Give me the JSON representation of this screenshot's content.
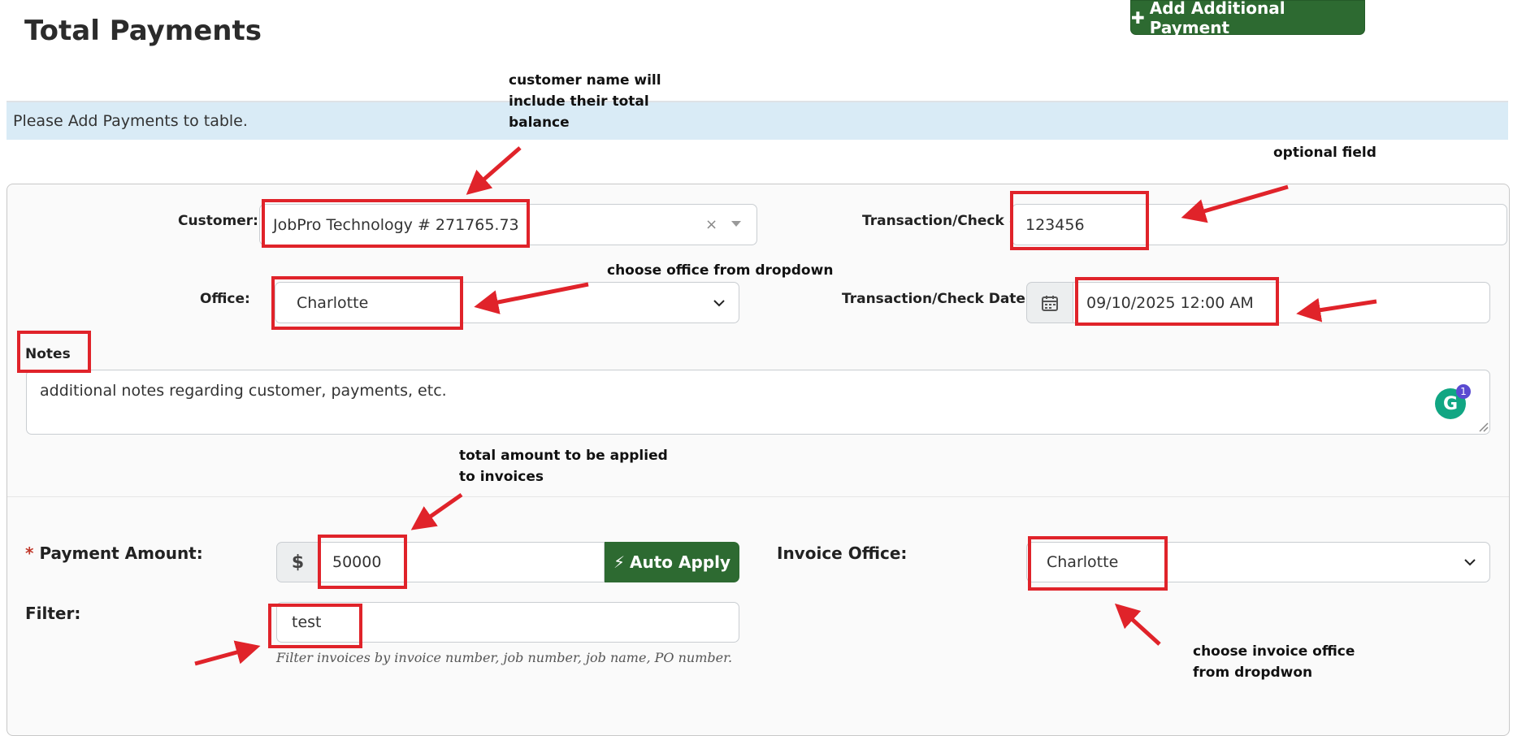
{
  "header": {
    "title": "Total Payments",
    "add_button_label": "Add Additional Payment",
    "add_button_icon": "plus-icon"
  },
  "info_bar": {
    "text": "Please Add Payments to table."
  },
  "form": {
    "customer": {
      "label": "Customer:",
      "value": "JobPro Technology # 271765.73",
      "clear_glyph": "×"
    },
    "transaction_number": {
      "label": "Transaction/Check #:",
      "value": "123456"
    },
    "office": {
      "label": "Office:",
      "value": "Charlotte"
    },
    "transaction_date": {
      "label": "Transaction/Check Date:",
      "value": "09/10/2025 12:00 AM"
    },
    "notes": {
      "label": "Notes",
      "value": "additional notes regarding customer, payments, etc.",
      "grammarly_badge": "1"
    },
    "payment_amount": {
      "required_mark": "*",
      "label": "Payment Amount:",
      "currency": "$",
      "value": "50000",
      "auto_apply_label": "Auto Apply"
    },
    "invoice_office": {
      "label": "Invoice Office:",
      "value": "Charlotte"
    },
    "filter": {
      "label": "Filter:",
      "value": "test",
      "help": "Filter invoices by invoice number, job number, job name, PO number."
    }
  },
  "annotations": {
    "customer_note": [
      "customer name will",
      "include their total",
      "balance"
    ],
    "optional_field": "optional field",
    "office_note": "choose office from dropdown",
    "amount_note": [
      "total amount to be applied",
      "to invoices"
    ],
    "invoice_office_note": [
      "choose invoice office",
      "from dropdwon"
    ]
  },
  "colors": {
    "brand_green": "#2d6a31",
    "annotation_red": "#e0232a",
    "info_bar": "#d9ebf6"
  }
}
